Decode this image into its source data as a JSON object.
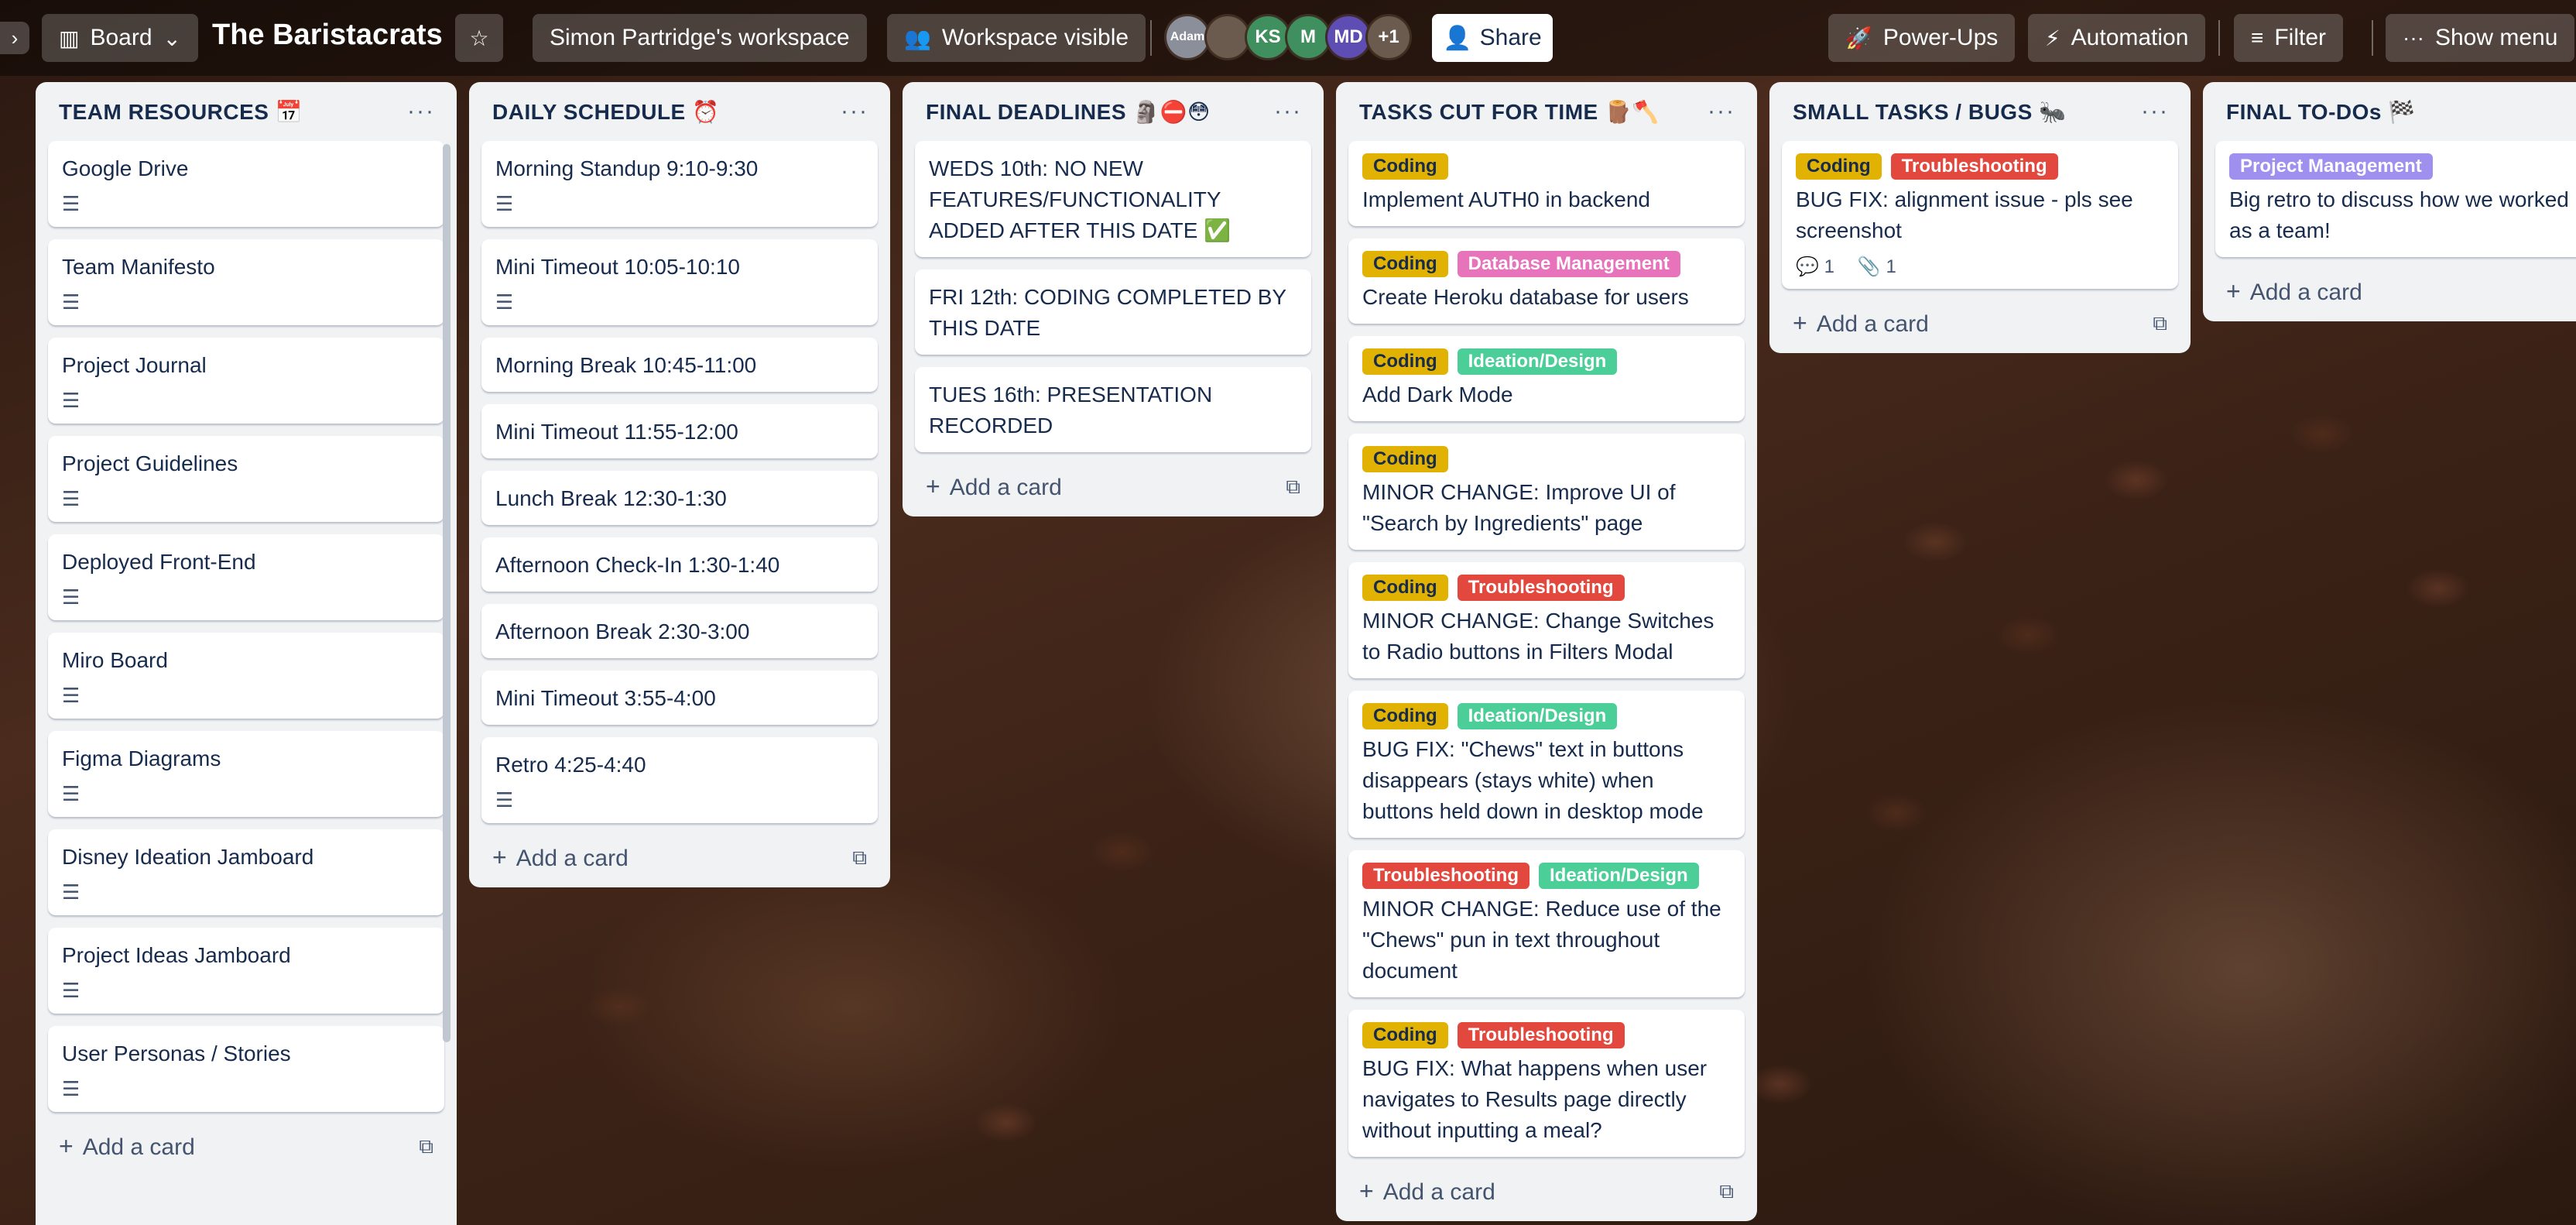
{
  "board": {
    "view_label": "Board",
    "title": "The Baristacrats",
    "workspace": "Simon Partridge's workspace",
    "visibility": "Workspace visible",
    "share_label": "Share",
    "power_ups": "Power-Ups",
    "automation": "Automation",
    "filter": "Filter",
    "show_menu": "Show menu"
  },
  "members": [
    {
      "initials": "Adam",
      "color": "#8a8f99"
    },
    {
      "initials": "",
      "color": "#6b5b4e"
    },
    {
      "initials": "KS",
      "color": "#3f8f5f"
    },
    {
      "initials": "M",
      "color": "#3f8f5f"
    },
    {
      "initials": "MD",
      "color": "#5e4db2"
    },
    {
      "initials": "+1",
      "color": "#6b5b4e"
    }
  ],
  "label_colors": {
    "Coding": "#e2b203",
    "Troubleshooting": "#e2483d",
    "Database Management": "#e774bb",
    "Ideation/Design": "#4bce97",
    "Project Management": "#9f8fef"
  },
  "add_card_label": "Add a card",
  "lists": [
    {
      "title": "TEAM RESOURCES 📅",
      "cards": [
        {
          "title": "Google Drive"
        },
        {
          "title": "Team Manifesto"
        },
        {
          "title": "Project Journal"
        },
        {
          "title": "Project Guidelines"
        },
        {
          "title": "Deployed Front-End"
        },
        {
          "title": "Miro Board"
        },
        {
          "title": "Figma Diagrams"
        },
        {
          "title": "Disney Ideation Jamboard"
        },
        {
          "title": "Project Ideas Jamboard"
        },
        {
          "title": "User Personas / Stories"
        }
      ]
    },
    {
      "title": "DAILY SCHEDULE ⏰",
      "cards": [
        {
          "title": "Morning Standup 9:10-9:30"
        },
        {
          "title": "Mini Timeout 10:05-10:10"
        },
        {
          "title": "Morning Break 10:45-11:00"
        },
        {
          "title": "Mini Timeout 11:55-12:00"
        },
        {
          "title": "Lunch Break 12:30-1:30"
        },
        {
          "title": "Afternoon Check-In 1:30-1:40"
        },
        {
          "title": "Afternoon Break 2:30-3:00"
        },
        {
          "title": "Mini Timeout 3:55-4:00"
        },
        {
          "title": "Retro 4:25-4:40"
        }
      ]
    },
    {
      "title": "FINAL DEADLINES 🗿⛔😳",
      "cards": [
        {
          "title": "WEDS 10th: NO NEW FEATURES/FUNCTIONALITY ADDED AFTER THIS DATE ✅"
        },
        {
          "title": "FRI 12th: CODING COMPLETED BY THIS DATE"
        },
        {
          "title": "TUES 16th: PRESENTATION RECORDED"
        }
      ]
    },
    {
      "title": "TASKS CUT FOR TIME 🪵🪓",
      "cards": [
        {
          "labels": [
            "Coding"
          ],
          "title": "Implement AUTH0 in backend"
        },
        {
          "labels": [
            "Coding",
            "Database Management"
          ],
          "title": "Create Heroku database for users"
        },
        {
          "labels": [
            "Coding",
            "Ideation/Design"
          ],
          "title": "Add Dark Mode"
        },
        {
          "labels": [
            "Coding"
          ],
          "title": "MINOR CHANGE: Improve UI of \"Search by Ingredients\" page"
        },
        {
          "labels": [
            "Coding",
            "Troubleshooting"
          ],
          "title": "MINOR CHANGE: Change Switches to Radio buttons in Filters Modal"
        },
        {
          "labels": [
            "Coding",
            "Ideation/Design"
          ],
          "title": "BUG FIX: \"Chews\" text in buttons disappears (stays white) when buttons held down in desktop mode"
        },
        {
          "labels": [
            "Troubleshooting",
            "Ideation/Design"
          ],
          "title": "MINOR CHANGE: Reduce use of the \"Chews\" pun in text throughout document"
        },
        {
          "labels": [
            "Coding",
            "Troubleshooting"
          ],
          "title": "BUG FIX: What happens when user navigates to Results page directly without inputting a meal?"
        }
      ]
    },
    {
      "title": "SMALL TASKS / BUGS 🐜",
      "cards": [
        {
          "labels": [
            "Coding",
            "Troubleshooting"
          ],
          "title": "BUG FIX: alignment issue - pls see screenshot",
          "comments": "1",
          "attachments": "1"
        }
      ]
    },
    {
      "title": "FINAL TO-DOs 🏁",
      "cards": [
        {
          "labels": [
            "Project Management"
          ],
          "title": "Big retro to discuss how we worked as a team!"
        }
      ]
    }
  ]
}
